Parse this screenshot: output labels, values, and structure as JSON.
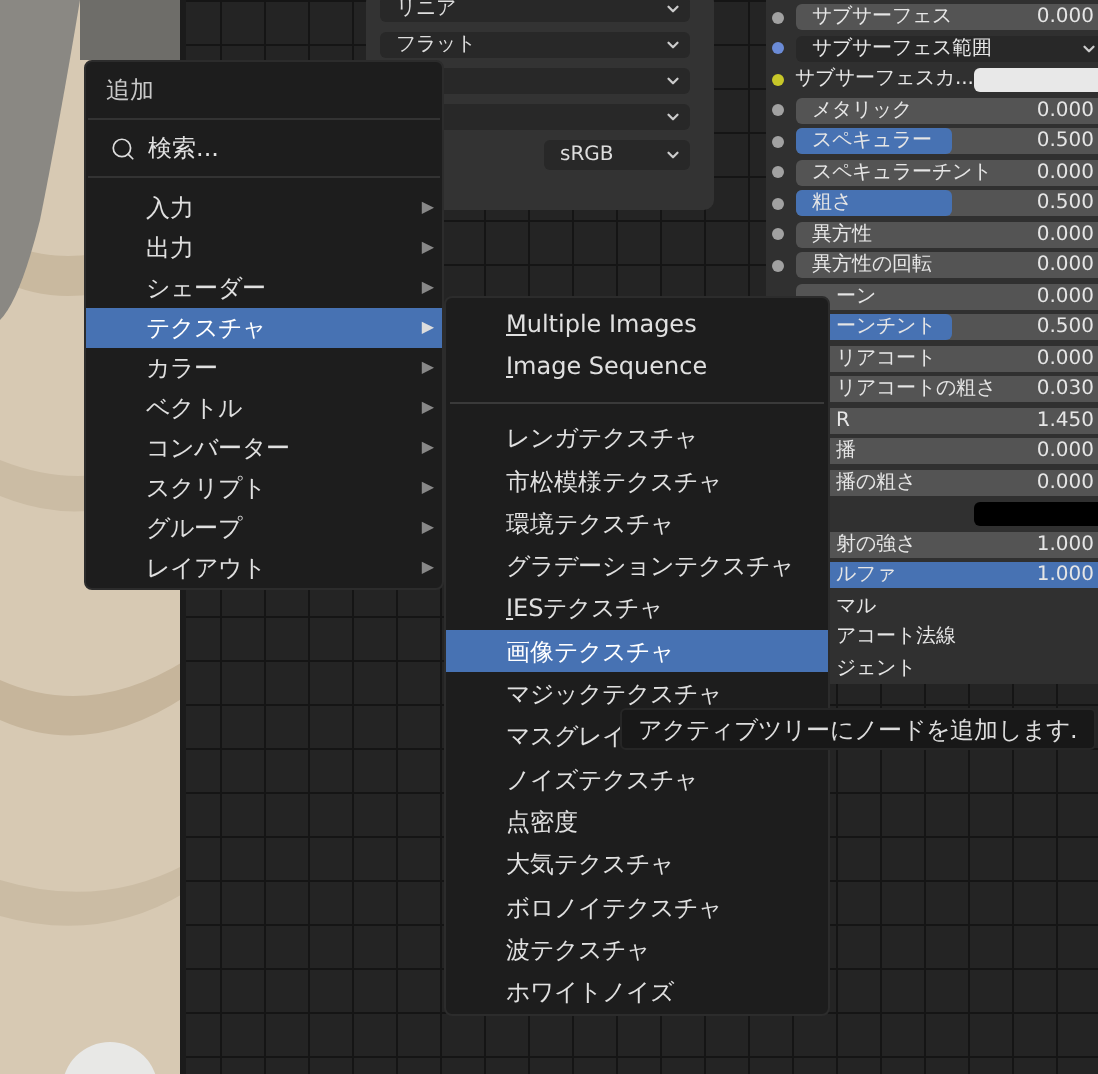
{
  "texture_node": {
    "dropdowns": [
      {
        "value": "リニア"
      },
      {
        "value": "フラット"
      }
    ],
    "color_space": "sRGB"
  },
  "bsdf_node": {
    "rows": [
      {
        "kind": "value",
        "label": "サブサーフェス",
        "value": "0.000",
        "socket": {
          "color": "#a1a1a1"
        }
      },
      {
        "kind": "menu",
        "label": "サブサーフェス範囲",
        "socket": {
          "color": "#6b8bd6"
        }
      },
      {
        "kind": "color",
        "label": "サブサーフェスカ...",
        "swatch": {
          "color": "#e8e8e8"
        },
        "socket": {
          "color": "#c7c729"
        }
      },
      {
        "kind": "value",
        "label": "メタリック",
        "value": "0.000",
        "socket": {
          "color": "#a1a1a1"
        }
      },
      {
        "kind": "slider",
        "label": "スペキュラー",
        "value": "0.500",
        "level": 0.5,
        "socket": {
          "color": "#a1a1a1"
        }
      },
      {
        "kind": "value",
        "label": "スペキュラーチント",
        "value": "0.000",
        "socket": {
          "color": "#a1a1a1"
        }
      },
      {
        "kind": "slider",
        "label": "粗さ",
        "value": "0.500",
        "level": 0.5,
        "socket": {
          "color": "#a1a1a1"
        }
      },
      {
        "kind": "value",
        "label": "異方性",
        "value": "0.000",
        "socket": {
          "color": "#a1a1a1"
        }
      },
      {
        "kind": "value",
        "label": "異方性の回転",
        "value": "0.000",
        "socket": {
          "color": "#a1a1a1"
        }
      },
      {
        "kind": "value",
        "label": "ーン",
        "value": "0.000"
      },
      {
        "kind": "slider",
        "label": "ーンチント",
        "value": "0.500",
        "level": 0.5
      },
      {
        "kind": "value",
        "label": "リアコート",
        "value": "0.000"
      },
      {
        "kind": "value",
        "label": "リアコートの粗さ",
        "value": "0.030"
      },
      {
        "kind": "value",
        "label": "R",
        "value": "1.450"
      },
      {
        "kind": "value",
        "label": "播",
        "value": "0.000"
      },
      {
        "kind": "value",
        "label": "播の粗さ",
        "value": "0.000"
      },
      {
        "kind": "color",
        "swatch": {
          "color": "#000000"
        }
      },
      {
        "kind": "value",
        "label": "射の強さ",
        "value": "1.000"
      },
      {
        "kind": "slider",
        "label": "ルファ",
        "value": "1.000",
        "level": 1
      },
      {
        "kind": "label",
        "label": "マル"
      },
      {
        "kind": "label",
        "label": "アコート法線"
      },
      {
        "kind": "label",
        "label": "ジェント"
      }
    ]
  },
  "add_menu": {
    "title": "追加",
    "search": {
      "label": "検索..."
    },
    "items": [
      {
        "label": "入力",
        "arrow": "▶",
        "selected": false
      },
      {
        "label": "出力",
        "arrow": "▶",
        "selected": false
      },
      {
        "label": "シェーダー",
        "arrow": "▶",
        "selected": false
      },
      {
        "label": "テクスチャ",
        "arrow": "▶",
        "selected": true
      },
      {
        "label": "カラー",
        "arrow": "▶",
        "selected": false
      },
      {
        "label": "ベクトル",
        "arrow": "▶",
        "selected": false
      },
      {
        "label": "コンバーター",
        "arrow": "▶",
        "selected": false
      },
      {
        "label": "スクリプト",
        "arrow": "▶",
        "selected": false
      },
      {
        "label": "グループ",
        "arrow": "▶",
        "selected": false
      },
      {
        "label": "レイアウト",
        "arrow": "▶",
        "selected": false
      }
    ]
  },
  "texture_submenu": {
    "groups": [
      [
        {
          "label": "Multiple Images",
          "mnemonic": true,
          "selected": false
        },
        {
          "label": "Image Sequence",
          "mnemonic": true,
          "selected": false
        }
      ],
      [
        {
          "label": "レンガテクスチャ",
          "mnemonic": false,
          "selected": false
        },
        {
          "label": "市松模様テクスチャ",
          "mnemonic": false,
          "selected": false
        },
        {
          "label": "環境テクスチャ",
          "mnemonic": false,
          "selected": false
        },
        {
          "label": "グラデーションテクスチャ",
          "mnemonic": false,
          "selected": false
        },
        {
          "label": "IESテクスチャ",
          "mnemonic": true,
          "selected": false
        },
        {
          "label": "画像テクスチャ",
          "mnemonic": false,
          "selected": true
        },
        {
          "label": "マジックテクスチャ",
          "mnemonic": false,
          "selected": false
        },
        {
          "label": "マスグレイ",
          "mnemonic": false,
          "selected": false
        },
        {
          "label": "ノイズテクスチャ",
          "mnemonic": false,
          "selected": false
        },
        {
          "label": "点密度",
          "mnemonic": false,
          "selected": false
        },
        {
          "label": "大気テクスチャ",
          "mnemonic": false,
          "selected": false
        },
        {
          "label": "ボロノイテクスチャ",
          "mnemonic": false,
          "selected": false
        },
        {
          "label": "波テクスチャ",
          "mnemonic": false,
          "selected": false
        },
        {
          "label": "ホワイトノイズ",
          "mnemonic": false,
          "selected": false
        }
      ]
    ]
  },
  "tooltip": "アクティブツリーにノードを追加します."
}
